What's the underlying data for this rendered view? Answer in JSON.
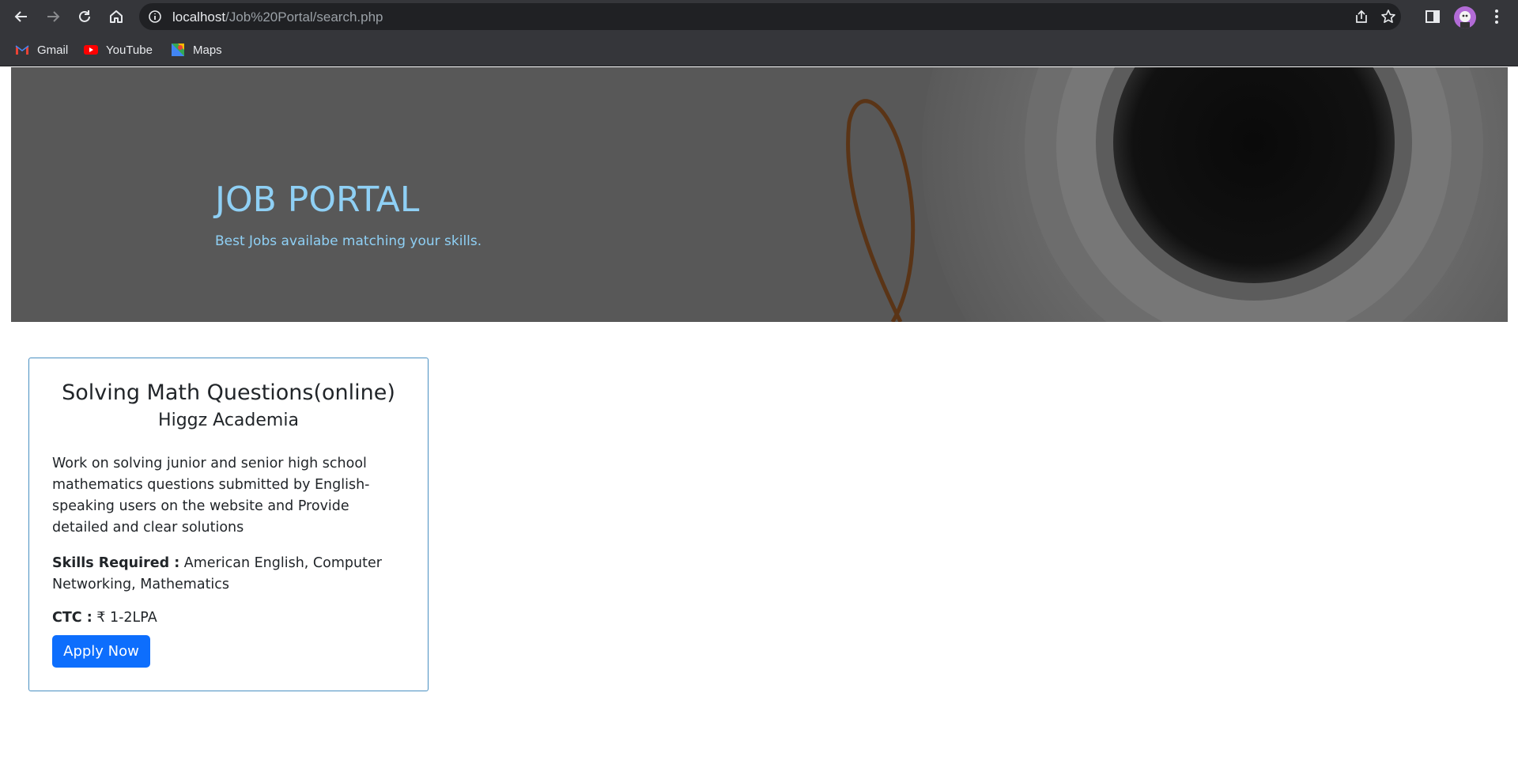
{
  "browser": {
    "url_host": "localhost",
    "url_path": "/Job%20Portal/search.php",
    "bookmarks": [
      {
        "label": "Gmail",
        "icon": "gmail-icon"
      },
      {
        "label": "YouTube",
        "icon": "youtube-icon"
      },
      {
        "label": "Maps",
        "icon": "maps-icon"
      }
    ]
  },
  "hero": {
    "title": "JOB PORTAL",
    "subtitle": "Best Jobs availabe matching your skills."
  },
  "job": {
    "title": "Solving Math Questions(online)",
    "company": "Higgz Academia",
    "description": "Work on solving junior and senior high school mathematics questions submitted by English-speaking users on the website and Provide detailed and clear solutions",
    "skills_label": "Skills Required :",
    "skills_value": " American English, Computer Networking, Mathematics",
    "ctc_label": "CTC :",
    "ctc_value": " ₹ 1-2LPA",
    "apply_label": "Apply Now"
  },
  "colors": {
    "accent": "#0d6efd",
    "hero_text": "#8fd0f5",
    "card_border": "#4a90c2"
  }
}
